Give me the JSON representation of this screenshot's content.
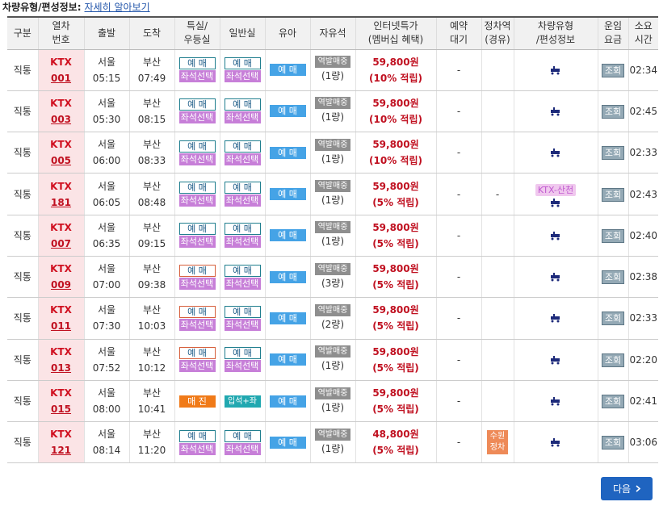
{
  "header": {
    "label": "차량유형/편성정보:",
    "link": "자세히 알아보기"
  },
  "columns": [
    [
      "구분"
    ],
    [
      "열차",
      "번호"
    ],
    [
      "출발"
    ],
    [
      "도착"
    ],
    [
      "특실/",
      "우등실"
    ],
    [
      "일반실"
    ],
    [
      "유아"
    ],
    [
      "자유석"
    ],
    [
      "인터넷특가",
      "(멤버십 혜택)"
    ],
    [
      "예약",
      "대기"
    ],
    [
      "정차역",
      "(경유)"
    ],
    [
      "차량유형",
      "/편성정보"
    ],
    [
      "운임",
      "요금"
    ],
    [
      "소요",
      "시간"
    ]
  ],
  "buttons": {
    "reserve": "예 매",
    "seat_select": "좌석선택",
    "sold_out": "매 진",
    "standing_seat": "입석+좌석",
    "baby": "예 매",
    "station_sale": "역발매중",
    "fare_lookup": "조회"
  },
  "rows": [
    {
      "type": "직통",
      "train_name": "KTX",
      "train_no": "001",
      "dep_station": "서울",
      "dep_time": "05:15",
      "arr_station": "부산",
      "arr_time": "07:49",
      "special_red": false,
      "general_state": "reserve",
      "free_seat_cars": "(1량)",
      "price": "59,800원",
      "benefit": "(10% 적립)",
      "waitlist": "-",
      "stops": "",
      "vehicle_badge": "",
      "fare": "조회",
      "duration": "02:34"
    },
    {
      "type": "직통",
      "train_name": "KTX",
      "train_no": "003",
      "dep_station": "서울",
      "dep_time": "05:30",
      "arr_station": "부산",
      "arr_time": "08:15",
      "special_red": false,
      "general_state": "reserve",
      "free_seat_cars": "(1량)",
      "price": "59,800원",
      "benefit": "(10% 적립)",
      "waitlist": "-",
      "stops": "",
      "vehicle_badge": "",
      "fare": "조회",
      "duration": "02:45"
    },
    {
      "type": "직통",
      "train_name": "KTX",
      "train_no": "005",
      "dep_station": "서울",
      "dep_time": "06:00",
      "arr_station": "부산",
      "arr_time": "08:33",
      "special_red": false,
      "general_state": "reserve",
      "free_seat_cars": "(1량)",
      "price": "59,800원",
      "benefit": "(10% 적립)",
      "waitlist": "-",
      "stops": "",
      "vehicle_badge": "",
      "fare": "조회",
      "duration": "02:33"
    },
    {
      "type": "직통",
      "train_name": "KTX",
      "train_no": "181",
      "dep_station": "서울",
      "dep_time": "06:05",
      "arr_station": "부산",
      "arr_time": "08:48",
      "special_red": false,
      "general_state": "reserve",
      "free_seat_cars": "(1량)",
      "price": "59,800원",
      "benefit": "(5% 적립)",
      "waitlist": "-",
      "stops": "-",
      "vehicle_badge": "KTX-산천",
      "fare": "조회",
      "duration": "02:43"
    },
    {
      "type": "직통",
      "train_name": "KTX",
      "train_no": "007",
      "dep_station": "서울",
      "dep_time": "06:35",
      "arr_station": "부산",
      "arr_time": "09:15",
      "special_red": false,
      "general_state": "reserve",
      "free_seat_cars": "(1량)",
      "price": "59,800원",
      "benefit": "(5% 적립)",
      "waitlist": "-",
      "stops": "",
      "vehicle_badge": "",
      "fare": "조회",
      "duration": "02:40"
    },
    {
      "type": "직통",
      "train_name": "KTX",
      "train_no": "009",
      "dep_station": "서울",
      "dep_time": "07:00",
      "arr_station": "부산",
      "arr_time": "09:38",
      "special_red": true,
      "general_state": "reserve",
      "free_seat_cars": "(3량)",
      "price": "59,800원",
      "benefit": "(5% 적립)",
      "waitlist": "-",
      "stops": "",
      "vehicle_badge": "",
      "fare": "조회",
      "duration": "02:38"
    },
    {
      "type": "직통",
      "train_name": "KTX",
      "train_no": "011",
      "dep_station": "서울",
      "dep_time": "07:30",
      "arr_station": "부산",
      "arr_time": "10:03",
      "special_red": true,
      "general_state": "reserve",
      "free_seat_cars": "(2량)",
      "price": "59,800원",
      "benefit": "(5% 적립)",
      "waitlist": "-",
      "stops": "",
      "vehicle_badge": "",
      "fare": "조회",
      "duration": "02:33"
    },
    {
      "type": "직통",
      "train_name": "KTX",
      "train_no": "013",
      "dep_station": "서울",
      "dep_time": "07:52",
      "arr_station": "부산",
      "arr_time": "10:12",
      "special_red": true,
      "general_state": "reserve",
      "free_seat_cars": "(1량)",
      "price": "59,800원",
      "benefit": "(5% 적립)",
      "waitlist": "-",
      "stops": "",
      "vehicle_badge": "",
      "fare": "조회",
      "duration": "02:20"
    },
    {
      "type": "직통",
      "train_name": "KTX",
      "train_no": "015",
      "dep_station": "서울",
      "dep_time": "08:00",
      "arr_station": "부산",
      "arr_time": "10:41",
      "special_red": false,
      "special_sold_out": true,
      "general_state": "standing",
      "free_seat_cars": "(1량)",
      "price": "59,800원",
      "benefit": "(5% 적립)",
      "waitlist": "-",
      "stops": "",
      "vehicle_badge": "",
      "fare": "조회",
      "duration": "02:41"
    },
    {
      "type": "직통",
      "train_name": "KTX",
      "train_no": "121",
      "dep_station": "서울",
      "dep_time": "08:14",
      "arr_station": "부산",
      "arr_time": "11:20",
      "special_red": false,
      "general_state": "reserve",
      "free_seat_cars": "(1량)",
      "price": "48,800원",
      "benefit": "(5% 적립)",
      "waitlist": "-",
      "stops": "수원 정차",
      "vehicle_badge": "",
      "fare": "조회",
      "duration": "03:06"
    }
  ],
  "footer": {
    "next": "다음"
  },
  "colors": {
    "train_number": "#c01020",
    "train_cell_bg": "#fbe4e6",
    "seat_select": "#c77fd8",
    "sold_out": "#f07a18",
    "baby": "#45a3e6",
    "next_button": "#1f64c0"
  }
}
